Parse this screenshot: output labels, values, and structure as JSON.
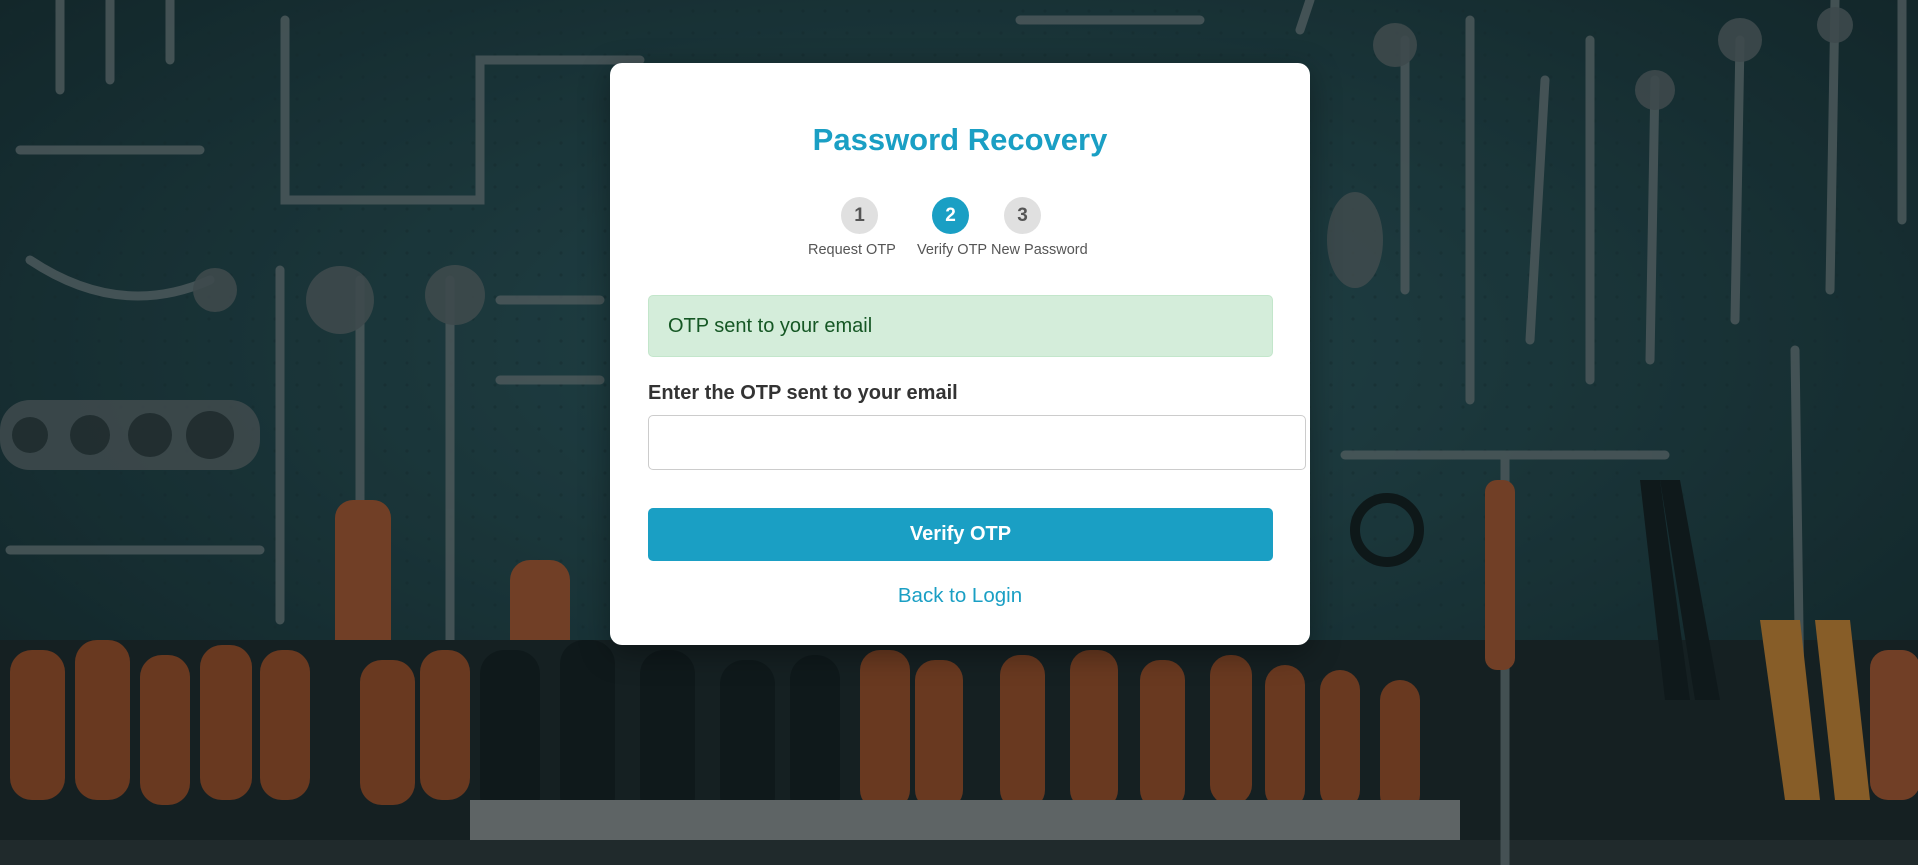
{
  "header": {
    "title": "Password Recovery"
  },
  "steps": [
    {
      "number": "1",
      "label": "Request OTP",
      "state": "inactive"
    },
    {
      "number": "2",
      "label": "Verify OTP",
      "state": "active"
    },
    {
      "number": "3",
      "label": "New Password",
      "state": "inactive"
    }
  ],
  "alert": {
    "message": "OTP sent to your email",
    "type": "success"
  },
  "form": {
    "otp_label": "Enter the OTP sent to your email",
    "otp_value": "",
    "otp_placeholder": "",
    "submit_label": "Verify OTP"
  },
  "links": {
    "back_to_login": "Back to Login"
  },
  "colors": {
    "accent": "#1a9fc4",
    "success_bg": "#d4edda",
    "success_text": "#155724",
    "inactive_step": "#e0e0e0"
  }
}
